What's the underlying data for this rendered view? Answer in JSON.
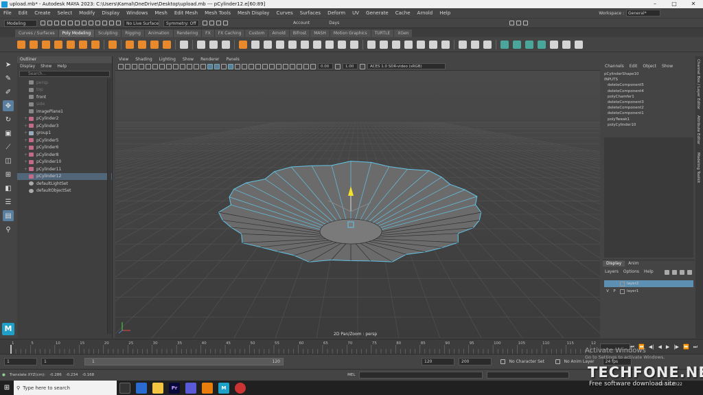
{
  "window": {
    "title": "upload.mb* - Autodesk MAYA 2023: C:\\Users\\Kamal\\OneDrive\\Desktop\\upload.mb  ---  pCylinder12.e[60:89]",
    "min": "–",
    "max": "□",
    "close": "✕"
  },
  "menus": [
    "File",
    "Edit",
    "Create",
    "Select",
    "Modify",
    "Display",
    "Windows",
    "Mesh",
    "Edit Mesh",
    "Mesh Tools",
    "Mesh Display",
    "Curves",
    "Surfaces",
    "Deform",
    "UV",
    "Generate",
    "Cache",
    "Arnold",
    "Help"
  ],
  "workspace": {
    "label": "Workspace :",
    "value": "General*"
  },
  "statusline": {
    "mode": "Modeling",
    "live_surface": "No Live Surface",
    "symmetry": "Symmetry: Off",
    "account": "Account",
    "days": "Days"
  },
  "shelf_tabs": [
    "Curves / Surfaces",
    "Poly Modeling",
    "Sculpting",
    "Rigging",
    "Animation",
    "Rendering",
    "FX",
    "FX Caching",
    "Custom",
    "Arnold",
    "Bifrost",
    "MASH",
    "Motion Graphics",
    "TURTLE",
    "XGen"
  ],
  "shelf_active": "Poly Modeling",
  "outliner": {
    "title": "Outliner",
    "menu": [
      "Display",
      "Show",
      "Help"
    ],
    "search_placeholder": "Search...",
    "items": [
      {
        "label": "persp",
        "icon": "cam",
        "dim": true,
        "expand": ""
      },
      {
        "label": "top",
        "icon": "cam",
        "dim": true,
        "expand": ""
      },
      {
        "label": "front",
        "icon": "cam",
        "dim": false,
        "expand": ""
      },
      {
        "label": "side",
        "icon": "cam",
        "dim": true,
        "expand": ""
      },
      {
        "label": "imagePlane1",
        "icon": "cam",
        "dim": false,
        "expand": ""
      },
      {
        "label": "pCylinder2",
        "icon": "mesh",
        "dim": false,
        "expand": "+"
      },
      {
        "label": "pCylinder3",
        "icon": "mesh",
        "dim": false,
        "expand": "+"
      },
      {
        "label": "group1",
        "icon": "grp",
        "dim": false,
        "expand": "+"
      },
      {
        "label": "pCylinder5",
        "icon": "mesh",
        "dim": false,
        "expand": "+"
      },
      {
        "label": "pCylinder6",
        "icon": "mesh",
        "dim": false,
        "expand": "+"
      },
      {
        "label": "pCylinder8",
        "icon": "mesh",
        "dim": false,
        "expand": "+"
      },
      {
        "label": "pCylinder10",
        "icon": "mesh",
        "dim": false,
        "expand": "+"
      },
      {
        "label": "pCylinder11",
        "icon": "mesh",
        "dim": false,
        "expand": "+"
      },
      {
        "label": "pCylinder12",
        "icon": "mesh",
        "dim": false,
        "expand": "",
        "selected": true
      },
      {
        "label": "defaultLightSet",
        "icon": "set",
        "dim": false,
        "expand": ""
      },
      {
        "label": "defaultObjectSet",
        "icon": "set",
        "dim": false,
        "expand": ""
      }
    ]
  },
  "viewport": {
    "menu": [
      "View",
      "Shading",
      "Lighting",
      "Show",
      "Renderer",
      "Panels"
    ],
    "exposure": "0.00",
    "gamma": "1.00",
    "colorspace": "ACES 1.0 SDR-video (sRGB)",
    "label": "2D Pan/Zoom : persp"
  },
  "channelbox": {
    "menu": [
      "Channels",
      "Edit",
      "Object",
      "Show"
    ],
    "shape": "pCylinderShape10",
    "inputs_label": "INPUTS",
    "inputs": [
      "deleteComponent5",
      "deleteComponent4",
      "polyChamfer1",
      "deleteComponent3",
      "deleteComponent2",
      "deleteComponent1",
      "polyTweak1",
      "polyCylinder10"
    ]
  },
  "side_tabs": [
    "Channel Box / Layer Editor",
    "Attribute Editor",
    "Modeling Toolkit"
  ],
  "layers": {
    "tabs": [
      "Display",
      "Anim"
    ],
    "menu": [
      "Layers",
      "Options",
      "Help"
    ],
    "rows": [
      {
        "v": "",
        "p": "",
        "name": "layer2",
        "selected": true
      },
      {
        "v": "V",
        "p": "P",
        "name": "layer1",
        "selected": false
      }
    ]
  },
  "timeslider": {
    "ticks": [
      "1",
      "5",
      "10",
      "15",
      "20",
      "25",
      "30",
      "35",
      "40",
      "45",
      "50",
      "55",
      "60",
      "65",
      "70",
      "75",
      "80",
      "85",
      "90",
      "95",
      "100",
      "105",
      "110",
      "115",
      "120"
    ]
  },
  "range": {
    "start": "1",
    "current": "1",
    "bar_start": "1",
    "bar_end": "120",
    "end": "120",
    "anim_end": "200",
    "character_set": "No Character Set",
    "anim_layer": "No Anim Layer",
    "fps": "24 fps"
  },
  "cmdline": {
    "readout_label": "Translate XYZ(cm):",
    "x": "-0.286",
    "y": "-0.234",
    "z": "-0.168",
    "mel": "MEL"
  },
  "taskbar": {
    "search_placeholder": "Type here to search",
    "apps": [
      "Pr",
      "M"
    ],
    "clock_time": "",
    "clock_date": "02-11-2022"
  },
  "watermark": {
    "activate_title": "Activate Windows",
    "activate_sub": "Go to Settings to activate Windows.",
    "brand": "TECHFONE.NET",
    "brand_sub": "Free software download site"
  },
  "colors": {
    "accent": "#5d8fb3",
    "wire": "#63c5e8",
    "maya": "#1ea0c8"
  }
}
